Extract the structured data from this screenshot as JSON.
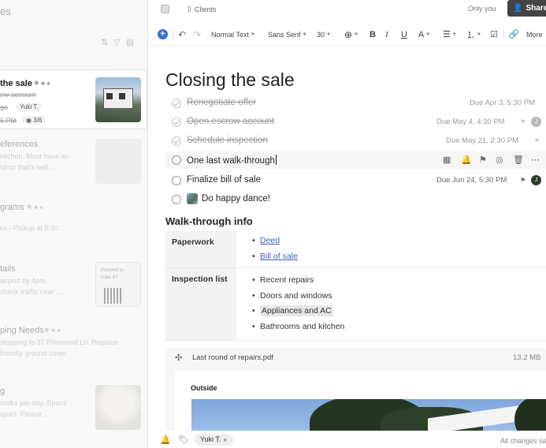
{
  "sidebar": {
    "heading": "es",
    "items": [
      {
        "title": "the sale",
        "snippet": "ew account",
        "snippet2": "go",
        "tag": "Yuki T.",
        "time": "6 PM",
        "tasks": "3/6"
      },
      {
        "title": "eferences",
        "snippet": "kitchen. Must have an",
        "snippet2": "idrop that's well ..."
      },
      {
        "title": "grams",
        "snippet": "ks - Pickup at 5:30."
      },
      {
        "title": "tails",
        "snippet": "airport by 4pm.",
        "snippet2": "check traffic near ...",
        "thumb_text": "Proceed to Gate B7"
      },
      {
        "title": "ping Needs",
        "snippet": "stopping to 37 Pinewood Ln. Replace",
        "snippet2": "friendly ground cover."
      },
      {
        "title": "g",
        "snippet": "walks per day. Space",
        "snippet2": "apart. Please ..."
      }
    ]
  },
  "topbar": {
    "notebook": "Clients",
    "only_you": "Only you",
    "share_label": "Share"
  },
  "toolbar": {
    "text_style": "Normal Text",
    "font": "Sans Serif",
    "size": "30",
    "more": "More"
  },
  "note": {
    "title": "Closing the sale",
    "tasks": [
      {
        "label": "Renegotiate offer",
        "done": true,
        "due": "Due Apr 3, 5:30 PM"
      },
      {
        "label": "Open escrow account",
        "done": true,
        "due": "Due May 4, 4:30 PM",
        "assignee": "J"
      },
      {
        "label": "Schedule inspection",
        "done": true,
        "due": "Due May 21, 2:30 PM"
      },
      {
        "label": "One last walk-through",
        "done": false,
        "due": ""
      },
      {
        "label": "Finalize bill of sale",
        "done": false,
        "due": "Due Jun 24, 5:30 PM",
        "assignee": "J"
      },
      {
        "label": "Do happy dance!",
        "done": false,
        "due": ""
      }
    ],
    "section_heading": "Walk-through info",
    "table": {
      "paperwork_label": "Paperwork",
      "paperwork_items": [
        "Deed",
        "Bill of sale"
      ],
      "inspection_label": "Inspection list",
      "inspection_items": [
        "Recent repairs",
        "Doors and windows",
        "Appliances and AC",
        "Bathrooms and kitchen"
      ]
    },
    "attachment": {
      "name": "Last round of repairs.pdf",
      "size": "13.2 MB",
      "page_heading": "Outside"
    }
  },
  "bottombar": {
    "tag": "Yuki T.",
    "status": "All changes sa"
  },
  "colors": {
    "accent": "#3b6fd4",
    "share_button": "#444444",
    "link": "#3b5fb8"
  }
}
